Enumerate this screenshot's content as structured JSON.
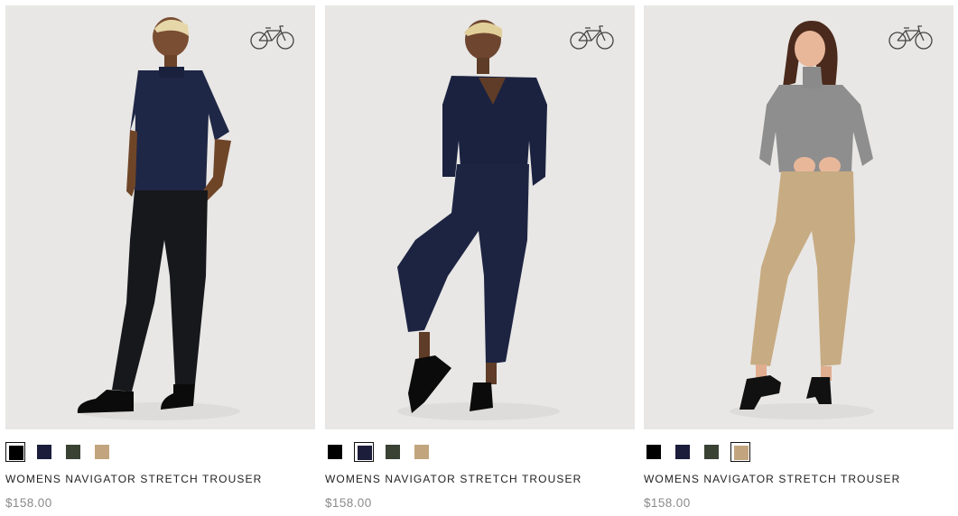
{
  "products": [
    {
      "title": "WOMENS NAVIGATOR STRETCH TROUSER",
      "price": "$158.00",
      "badge_icon": "bicycle-icon",
      "selected_swatch": 0,
      "swatches": [
        {
          "color": "#000000"
        },
        {
          "color": "#1c1d3b"
        },
        {
          "color": "#3a4233"
        },
        {
          "color": "#c2a57e"
        }
      ]
    },
    {
      "title": "WOMENS NAVIGATOR STRETCH TROUSER",
      "price": "$158.00",
      "badge_icon": "bicycle-icon",
      "selected_swatch": 1,
      "swatches": [
        {
          "color": "#000000"
        },
        {
          "color": "#1c1d3b"
        },
        {
          "color": "#3a4233"
        },
        {
          "color": "#c2a57e"
        }
      ]
    },
    {
      "title": "WOMENS NAVIGATOR STRETCH TROUSER",
      "price": "$158.00",
      "badge_icon": "bicycle-icon",
      "selected_swatch": 3,
      "swatches": [
        {
          "color": "#000000"
        },
        {
          "color": "#1c1d3b"
        },
        {
          "color": "#3a4233"
        },
        {
          "color": "#c2a57e"
        }
      ]
    }
  ]
}
